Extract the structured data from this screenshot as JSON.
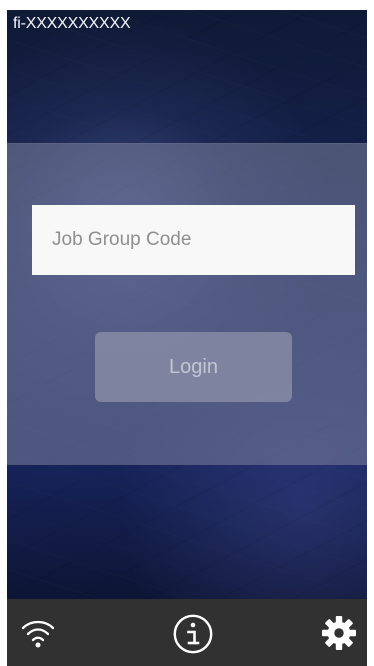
{
  "header": {
    "device_id": "fi-XXXXXXXXXX"
  },
  "login": {
    "job_group_placeholder": "Job Group Code",
    "login_label": "Login"
  },
  "footer": {
    "icons": [
      "wifi-icon",
      "info-icon",
      "gear-icon"
    ]
  },
  "colors": {
    "background_top": "#101b39",
    "background_mid": "#1a2a66",
    "panel": "#7b819d",
    "footer": "#313131",
    "icon": "#ffffff"
  }
}
